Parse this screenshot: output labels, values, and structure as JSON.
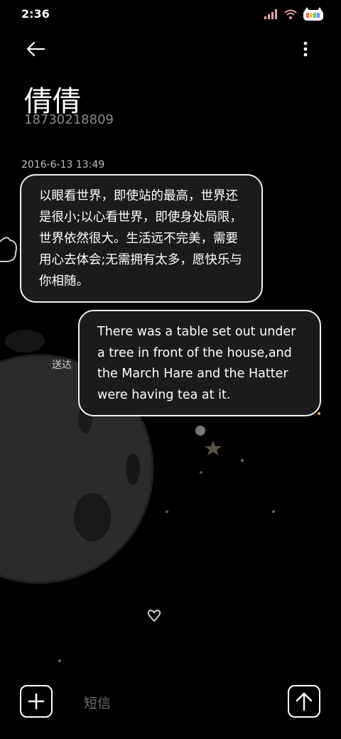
{
  "status": {
    "time": "2:36",
    "battery_icon": "cat-battery-icon"
  },
  "header": {
    "back_icon": "back-arrow-icon",
    "more_icon": "more-vertical-icon"
  },
  "contact": {
    "name": "倩倩",
    "number": "18730218809"
  },
  "messages": [
    {
      "timestamp": "2016-6-13 13:49",
      "direction": "incoming",
      "text": "以眼看世界，即使站的最高，世界还是很小;以心看世界，即使身处局限，世界依然很大。生活远不完美，需要用心去体会;无需拥有太多，愿快乐与你相随。"
    },
    {
      "direction": "outgoing",
      "status": "送达",
      "text": "There was a table set out under a tree in front of the house,and the March Hare and the Hatter were having tea at it."
    }
  ],
  "composer": {
    "placeholder": "短信",
    "add_icon": "add-icon",
    "send_icon": "send-arrow-icon"
  },
  "colors": {
    "background": "#000000",
    "bubble": "#1b1b1b",
    "border": "#f2f2f2",
    "moon": "#2e2e2e",
    "crescent": "#8a7a4a"
  }
}
